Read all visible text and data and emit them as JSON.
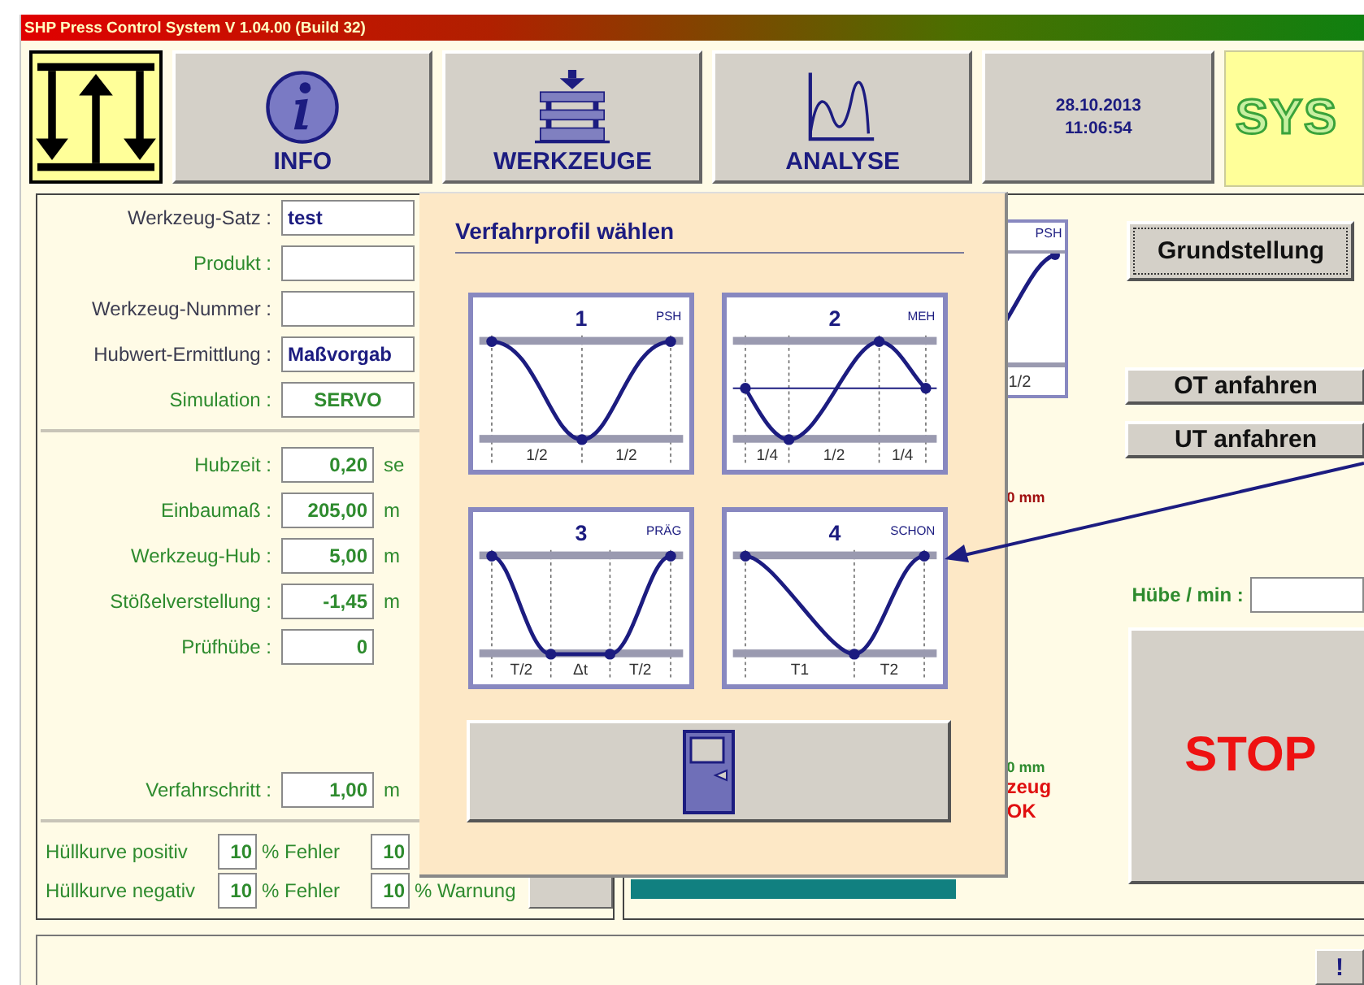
{
  "window": {
    "title": "SHP Press Control System V 1.04.00 (Build 32)"
  },
  "toolbar": [
    {
      "kind": "logo"
    },
    {
      "kind": "info",
      "label": "INFO"
    },
    {
      "kind": "tools",
      "label": "WERKZEUGE"
    },
    {
      "kind": "analysis",
      "label": "ANALYSE"
    }
  ],
  "datetime": {
    "date": "28.10.2013",
    "time": "11:06:54"
  },
  "brand_logo": {
    "text": "SYS"
  },
  "tool_fields": [
    {
      "label": "Werkzeug-Satz :",
      "value": "test",
      "kind": "text",
      "color": "#3c3c50"
    },
    {
      "label": "Produkt :",
      "kind": "text",
      "color": "#2e8b2e"
    },
    {
      "label": "Werkzeug-Nummer :",
      "kind": "text",
      "color": "#3c3c50"
    },
    {
      "label": "Hubwert-Ermittlung :",
      "value": "Maßvorgab",
      "kind": "text",
      "color": "#3c3c50"
    },
    {
      "label": "Simulation :",
      "value": "SERVO",
      "kind": "choice",
      "color": "#2e8b2e"
    }
  ],
  "process_fields": [
    {
      "label": "Hubzeit :",
      "value": "0,20",
      "unit": "se"
    },
    {
      "label": "Einbaumaß :",
      "value": "205,00",
      "unit": "m"
    },
    {
      "label": "Werkzeug-Hub :",
      "value": "5,00",
      "unit": "m"
    },
    {
      "label": "Stößelverstellung :",
      "value": "-1,45",
      "unit": "m"
    },
    {
      "label": "Prüfhübe :",
      "value": "0"
    }
  ],
  "step_field": {
    "label": "Verfahrschritt :",
    "value": "1,00",
    "unit": "m"
  },
  "envelope": [
    {
      "label": "Hüllkurve positiv",
      "error": "10",
      "error_label": "% Fehler",
      "warning": "10"
    },
    {
      "label": "Hüllkurve negativ",
      "error": "10",
      "error_label": "% Fehler",
      "warning": "10",
      "warning_label": "% Warnung"
    }
  ],
  "dialog": {
    "title": "Verfahrprofil wählen",
    "profiles": [
      {
        "number": "1",
        "tag": "PSH",
        "kind": "psh",
        "segments": [
          "1/2",
          "1/2"
        ]
      },
      {
        "number": "2",
        "tag": "MEH",
        "kind": "meh",
        "segments": [
          "1/4",
          "1/2",
          "1/4"
        ]
      },
      {
        "number": "3",
        "tag": "PRÄG",
        "kind": "prag",
        "segments": [
          "T/2",
          "Δt",
          "T/2"
        ]
      },
      {
        "number": "4",
        "tag": "SCHON",
        "kind": "schon",
        "segments": [
          "T1",
          "T2"
        ]
      }
    ]
  },
  "right_panel": {
    "profile_preview": {
      "tag": "PSH",
      "segment": "1/2"
    },
    "upper_reading": "0 mm",
    "lower_reading": "0 mm",
    "status_lines": [
      "zeug",
      "OK"
    ],
    "home_button": "Grundstellung",
    "top_button": "OT anfahren",
    "bottom_button": "UT anfahren",
    "strokes_label": "Hübe / min :",
    "stop_button": "STOP"
  },
  "status_bar": {
    "button": "!"
  }
}
